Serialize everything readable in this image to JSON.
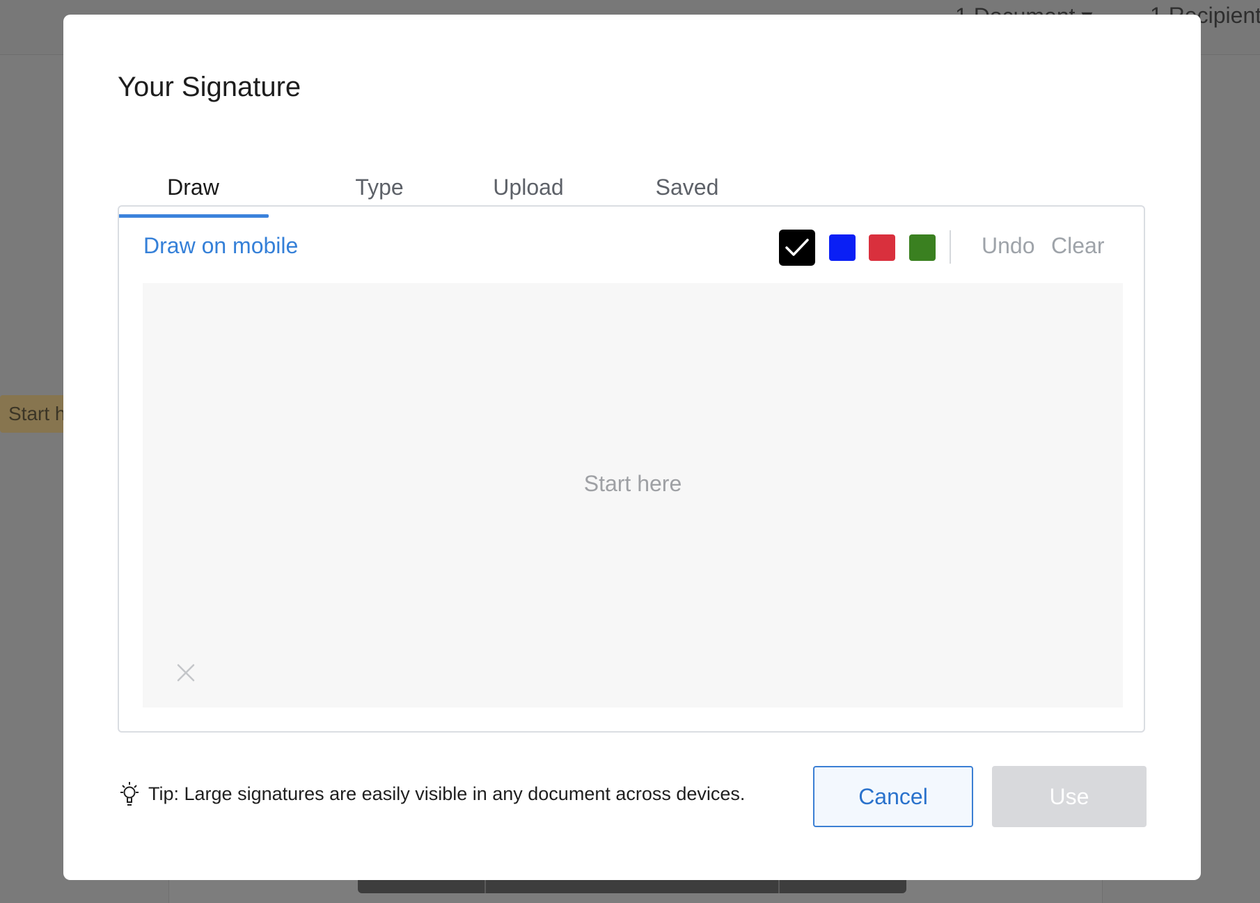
{
  "background": {
    "top_right_items": [
      "1 Document ▾",
      "1 Recipient"
    ],
    "side_tag": "Start h"
  },
  "modal": {
    "title": "Your Signature",
    "tabs": [
      {
        "label": "Draw",
        "active": true
      },
      {
        "label": "Type",
        "active": false
      },
      {
        "label": "Upload",
        "active": false
      },
      {
        "label": "Saved",
        "active": false
      }
    ],
    "draw_on_mobile": "Draw on mobile",
    "colors": [
      {
        "name": "black",
        "hex": "#000000",
        "selected": true
      },
      {
        "name": "blue",
        "hex": "#0a1ff5",
        "selected": false
      },
      {
        "name": "red",
        "hex": "#d9303d",
        "selected": false
      },
      {
        "name": "green",
        "hex": "#3a8020",
        "selected": false
      }
    ],
    "undo_label": "Undo",
    "clear_label": "Clear",
    "canvas_placeholder": "Start here",
    "tip_text": "Tip: Large signatures are easily visible in any document across devices.",
    "cancel_label": "Cancel",
    "use_label": "Use",
    "accent_color": "#3b82dc"
  }
}
